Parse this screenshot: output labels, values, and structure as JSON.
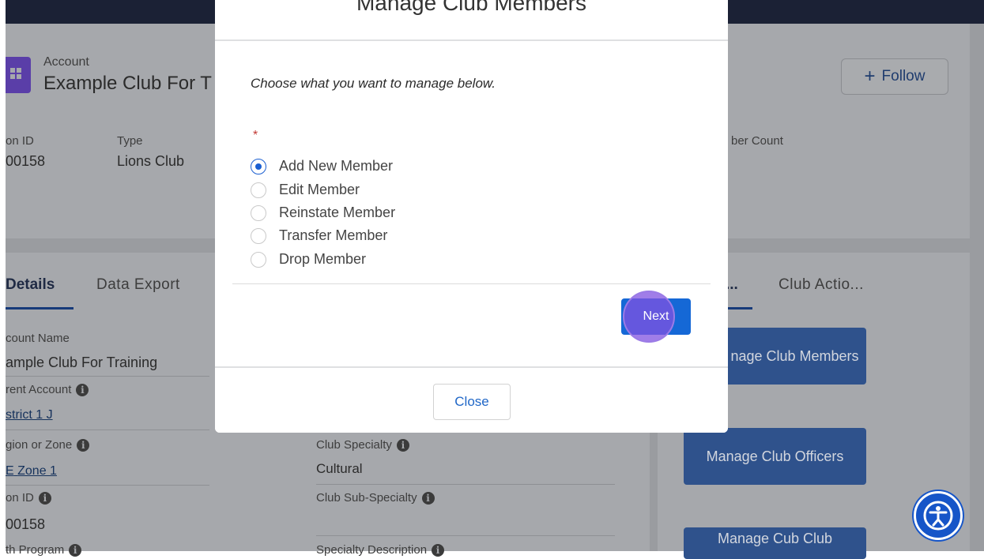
{
  "header": {
    "object_label": "Account",
    "record_name": "Example Club For T",
    "follow_label": "Follow",
    "fields": [
      {
        "label": "on ID",
        "value": "00158"
      },
      {
        "label": "Type",
        "value": "Lions Club"
      },
      {
        "label": "ber Count",
        "value": ""
      }
    ]
  },
  "tabs": {
    "left": [
      "Details",
      "Data Export"
    ],
    "right": [
      "...",
      "Club Actio..."
    ]
  },
  "details": {
    "account_name_label": "count Name",
    "account_name_value": "ample Club For Training",
    "parent_account_label": "rent Account",
    "parent_account_value": "strict 1 J",
    "region_label": "gion or Zone",
    "region_value": "Zone 1",
    "region_value_prefix": "E",
    "on_id_label": "on ID",
    "on_id_value": "00158",
    "bottom_left_label": "th Program",
    "club_specialty_label": "Club Specialty",
    "club_specialty_value": "Cultural",
    "club_sub_specialty_label": "Club Sub-Specialty",
    "specialty_description_label": "Specialty Description"
  },
  "actions": {
    "manage_members": "nage Club Members",
    "manage_officers": "Manage Club Officers",
    "manage_cub": "Manage Cub Club"
  },
  "modal": {
    "title": "Manage Club Members",
    "prompt": "Choose what you want to manage below.",
    "required_mark": "*",
    "options": [
      "Add New Member",
      "Edit Member",
      "Reinstate Member",
      "Transfer Member",
      "Drop Member"
    ],
    "selected_option": "Add New Member",
    "next_label": "Next",
    "close_label": "Close"
  },
  "icons": {
    "info": "i",
    "plus": "+"
  },
  "colors": {
    "brand_blue": "#1568d6",
    "overlay_gray": "#9a9ca0",
    "required_red": "#c23934",
    "highlight_purple": "#8052e0"
  }
}
